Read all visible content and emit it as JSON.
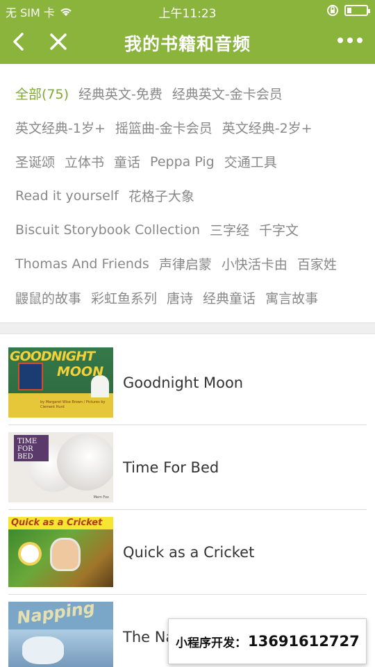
{
  "status": {
    "carrier": "无 SIM 卡",
    "time": "上午11:23",
    "icons": [
      "wifi-icon",
      "rotation-lock-icon",
      "battery-icon"
    ]
  },
  "nav": {
    "title": "我的书籍和音频",
    "back_icon": "chevron-left-icon",
    "close_icon": "close-icon",
    "more_icon": "more-dots-icon"
  },
  "tags": {
    "active_color": "#7ea832",
    "rows": [
      [
        "全部(75)",
        "经典英文-免费",
        "经典英文-金卡会员"
      ],
      [
        "英文经典-1岁+",
        "摇篮曲-金卡会员",
        "英文经典-2岁+"
      ],
      [
        "圣诞颂",
        "立体书",
        "童话",
        "Peppa Pig",
        "交通工具"
      ],
      [
        "Read it yourself",
        "花格子大象"
      ],
      [
        "Biscuit Storybook Collection",
        "三字经",
        "千字文"
      ],
      [
        "Thomas And Friends",
        "声律启蒙",
        "小快活卡由",
        "百家姓"
      ],
      [
        "鼹鼠的故事",
        "彩虹鱼系列",
        "唐诗",
        "经典童话",
        "寓言故事"
      ]
    ]
  },
  "books": [
    {
      "title": "Goodnight Moon",
      "cover": {
        "line1": "GOODNIGHT",
        "line2": "MOON",
        "byline": "by Margaret Wise Brown / Pictures by Clement Hurd"
      }
    },
    {
      "title": "Time For Bed",
      "cover": {
        "line1": "TIME FOR BED",
        "byline": "Mem Fox"
      }
    },
    {
      "title": "Quick as a Cricket",
      "cover": {
        "line1": "Quick as a Cricket"
      }
    },
    {
      "title": "The Na",
      "cover": {
        "line1": "Napping"
      }
    }
  ],
  "badge": {
    "label": "小程序开发：",
    "phone": "13691612727"
  },
  "colors": {
    "brand_green": "#8ab43c",
    "tag_text": "#888888"
  }
}
